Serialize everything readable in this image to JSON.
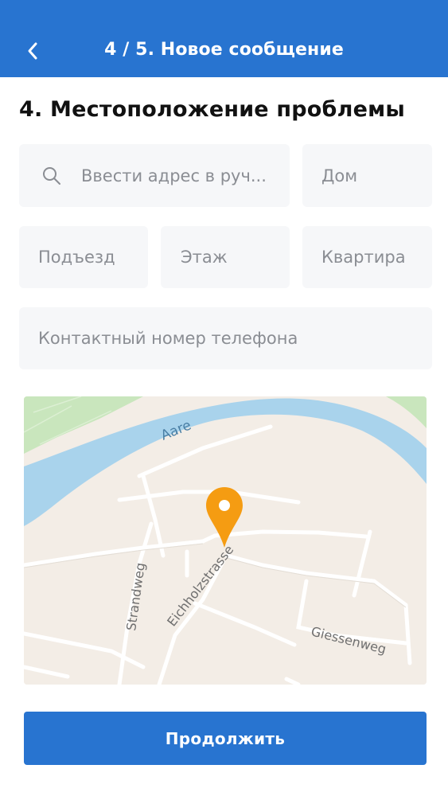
{
  "header": {
    "title": "4 / 5. Новое сообщение",
    "back_icon": "chevron-left-icon"
  },
  "section": {
    "title": "4. Местоположение проблемы"
  },
  "form": {
    "address_placeholder": "Ввести адрес в руч...",
    "house_placeholder": "Дом",
    "entrance_placeholder": "Подъезд",
    "floor_placeholder": "Этаж",
    "apartment_placeholder": "Квартира",
    "phone_placeholder": "Контактный номер телефона",
    "search_icon": "search-icon"
  },
  "map": {
    "labels": {
      "river": "Aare",
      "street_1": "Strandweg",
      "street_2": "Eichholzstrasse",
      "street_3": "Giessenweg"
    },
    "marker_icon": "location-pin-icon",
    "colors": {
      "land": "#f3ede6",
      "water": "#a9d3ec",
      "park": "#c9e6bd",
      "road": "#ffffff",
      "marker": "#f59c12"
    }
  },
  "actions": {
    "continue_label": "Продолжить"
  },
  "theme": {
    "primary": "#2874d0"
  }
}
